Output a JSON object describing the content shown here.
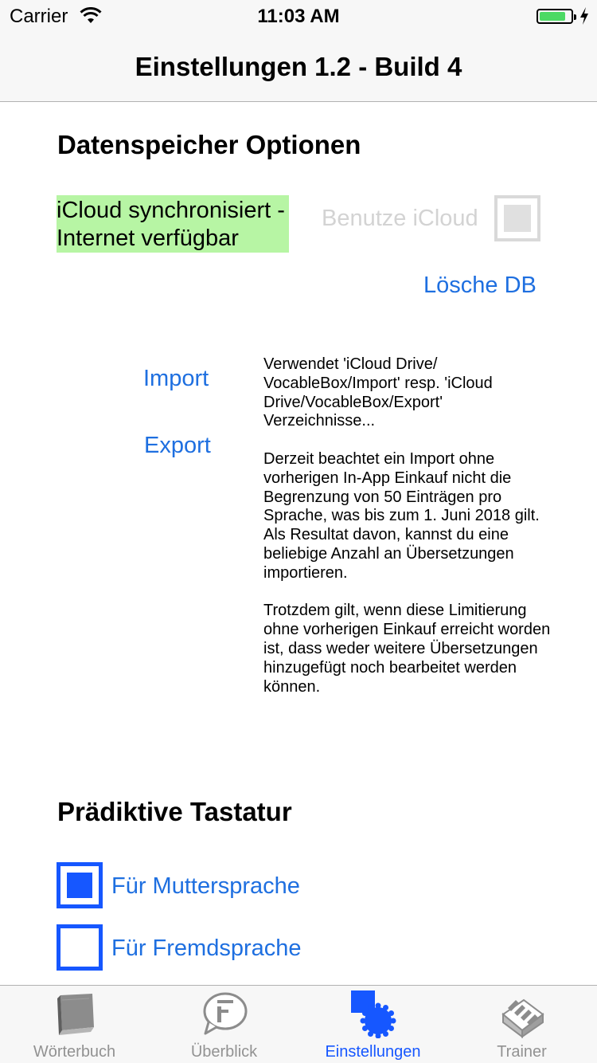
{
  "status_bar": {
    "carrier": "Carrier",
    "time": "11:03 AM",
    "battery_level": 0.85,
    "battery_color": "#4cd964"
  },
  "nav": {
    "title": "Einstellungen 1.2 - Build 4"
  },
  "storage": {
    "section_title": "Datenspeicher Optionen",
    "sync_status": "iCloud synchronisiert - Internet verfügbar",
    "sync_status_color": "#b7f5a4",
    "use_icloud_label": "Benutze iCloud",
    "use_icloud_checked": false,
    "use_icloud_enabled": false,
    "delete_db_label": "Lösche DB",
    "import_label": "Import",
    "export_label": "Export",
    "info_text": "Verwendet 'iCloud Drive/ VocableBox/Import' resp. 'iCloud Drive/VocableBox/Export' Verzeichnisse...\n\nDerzeit beachtet ein Import ohne vorherigen In-App Einkauf nicht die Begrenzung von 50 Einträgen pro Sprache, was bis zum 1. Juni 2018 gilt. Als Resultat davon, kannst du eine beliebige Anzahl an Übersetzungen importieren.\n\nTrotzdem gilt, wenn diese Limitierung ohne vorherigen Einkauf erreicht worden ist, dass weder weitere Übersetzungen hinzugefügt noch bearbeitet werden können."
  },
  "keyboard": {
    "section_title": "Prädiktive Tastatur",
    "options": [
      {
        "label": "Für Muttersprache",
        "checked": true
      },
      {
        "label": "Für Fremdsprache",
        "checked": false
      }
    ]
  },
  "tabs": [
    {
      "label": "Wörterbuch",
      "icon": "book-icon",
      "active": false
    },
    {
      "label": "Überblick",
      "icon": "speech-bubble-icon",
      "active": false
    },
    {
      "label": "Einstellungen",
      "icon": "gear-icon",
      "active": true
    },
    {
      "label": "Trainer",
      "icon": "card-box-icon",
      "active": false
    }
  ],
  "colors": {
    "link": "#1e6fe0",
    "accent": "#1657ff",
    "inactive_tab": "#929292"
  }
}
